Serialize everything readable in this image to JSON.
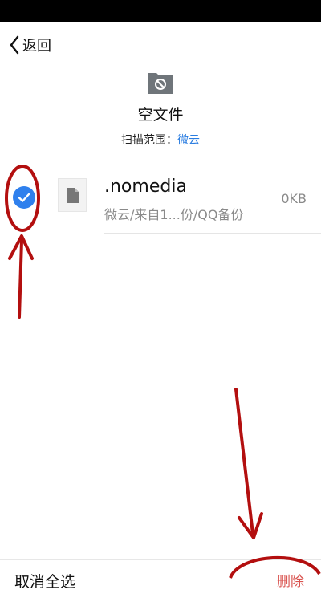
{
  "nav": {
    "back_label": "返回"
  },
  "header": {
    "title": "空文件",
    "scan_label": "扫描范围：",
    "scan_value": "微云"
  },
  "file": {
    "name": ".nomedia",
    "path": "微云/来自1...份/QQ备份",
    "size": "0KB",
    "selected": true
  },
  "bottom": {
    "deselect_all_label": "取消全选",
    "delete_label": "删除"
  },
  "colors": {
    "accent": "#2f80ed",
    "link": "#2a7de1",
    "annotation": "#b30f0f"
  },
  "icons": [
    "back-icon",
    "folder-icon",
    "check-icon",
    "file-icon"
  ]
}
